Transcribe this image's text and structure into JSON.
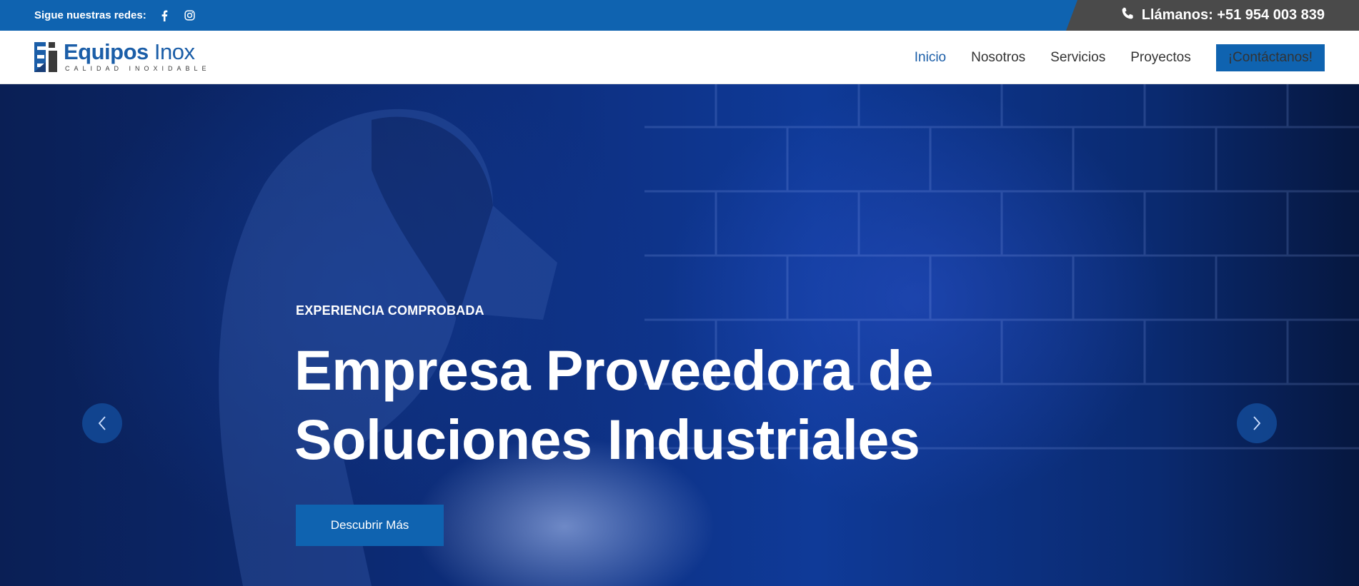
{
  "topbar": {
    "social_label": "Sigue nuestras redes:",
    "social_icons": [
      "facebook-icon",
      "instagram-icon"
    ],
    "phone_icon": "phone-icon",
    "phone_text": "Llámanos: +51 954 003 839"
  },
  "header": {
    "logo": {
      "brand": "Equipos",
      "brand_thin": "Inox",
      "tagline": "CALIDAD INOXIDABLE"
    },
    "nav": [
      {
        "label": "Inicio",
        "active": true
      },
      {
        "label": "Nosotros",
        "active": false
      },
      {
        "label": "Servicios",
        "active": false
      },
      {
        "label": "Proyectos",
        "active": false
      }
    ],
    "cta_label": "¡Contáctanos!"
  },
  "hero": {
    "kicker": "EXPERIENCIA COMPROBADA",
    "headline_line1": "Empresa Proveedora de",
    "headline_line2": "Soluciones Industriales",
    "button_label": "Descubrir Más",
    "prev_icon": "chevron-left-icon",
    "next_icon": "chevron-right-icon"
  },
  "colors": {
    "primary": "#0f63b0",
    "topbar_right": "#4a4a4a",
    "nav_active": "#1b5ea8",
    "hero_base": "#0d2f80"
  }
}
